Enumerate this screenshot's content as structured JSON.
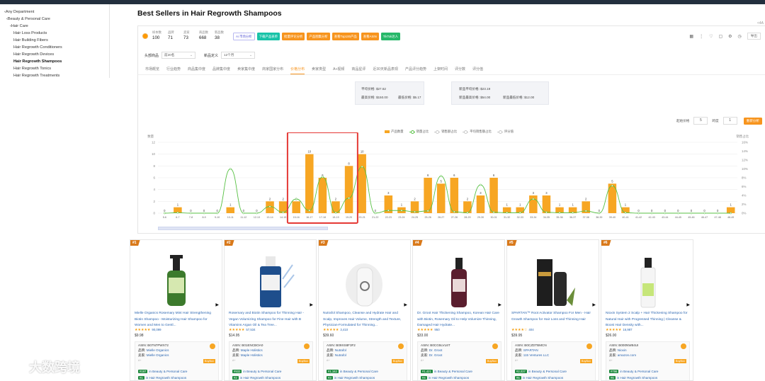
{
  "sidebar": [
    {
      "label": "‹Any Department",
      "level": 0
    },
    {
      "label": "‹Beauty & Personal Care",
      "level": 1
    },
    {
      "label": "‹Hair Care",
      "level": 2
    },
    {
      "label": "Hair Loss Products",
      "level": 3
    },
    {
      "label": "Hair Building Fibers",
      "level": 3
    },
    {
      "label": "Hair Regrowth Conditioners",
      "level": 3
    },
    {
      "label": "Hair Regrowth Devices",
      "level": 3
    },
    {
      "label": "Hair Regrowth Shampoos",
      "level": 3,
      "active": true
    },
    {
      "label": "Hair Regrowth Tonics",
      "level": 3
    },
    {
      "label": "Hair Regrowth Treatments",
      "level": 3
    }
  ],
  "page_title": "Best Sellers in Hair Regrowth Shampoos",
  "corner_label": "<4A",
  "stats": [
    {
      "label": "样本数",
      "value": "100"
    },
    {
      "label": "品牌",
      "value": "71"
    },
    {
      "label": "卖家",
      "value": "73"
    },
    {
      "label": "商品数",
      "value": "668"
    },
    {
      "label": "新品数",
      "value": "38"
    }
  ],
  "action_buttons": [
    {
      "label": "Ai 市场分析",
      "style": "ai"
    },
    {
      "label": "下载产品表单",
      "style": "teal"
    },
    {
      "label": "批量评论分析",
      "style": "orange"
    },
    {
      "label": "产品图集分析",
      "style": "orange"
    },
    {
      "label": "查看Top100产品",
      "style": "orange"
    },
    {
      "label": "查看ASIN",
      "style": "orange"
    },
    {
      "label": "TikTok达人",
      "style": "green"
    }
  ],
  "tool_icons": [
    "grid-icon",
    "more-icon",
    "heart-icon",
    "save-icon",
    "settings-icon",
    "history-icon"
  ],
  "export_label": "导出",
  "filters": {
    "head_label": "头部商品",
    "head_value": "前20名",
    "period_label": "新品定义",
    "period_value": "12个月"
  },
  "tabs": [
    "市场概览",
    "行业趋势",
    "商品集中度",
    "品牌集中度",
    "卖家集中度",
    "商家国家分布",
    "价格分布",
    "卖家类型",
    "A+视频",
    "商品星评",
    "近30天新品表现",
    "产品评分趋势",
    "上架时间",
    "评分数",
    "评分值"
  ],
  "active_tab": "价格分布",
  "price_summary_1": {
    "avg_label": "平均价格:",
    "avg": "$27.62",
    "max_label": "最高价格:",
    "max": "$150.00",
    "min_label": "最低价格:",
    "min": "$5.17"
  },
  "price_summary_2": {
    "avg_label": "新品平均价格:",
    "avg": "$23.19",
    "max_label": "新品最高价格:",
    "max": "$54.00",
    "min_label": "新品最低价格:",
    "min": "$12.00"
  },
  "range_controls": {
    "start_label": "起始价格",
    "start_value": "5",
    "step_label": "跨度",
    "step_value": "1",
    "button_label": "重新分析"
  },
  "legend": [
    {
      "label": "产品数量",
      "kind": "bar",
      "color": "#f7a623"
    },
    {
      "label": "销量占比",
      "kind": "line",
      "color": "#58c144"
    },
    {
      "label": "销售额占比",
      "kind": "line",
      "color": "#c8c8c8"
    },
    {
      "label": "平均销售额占比",
      "kind": "line",
      "color": "#c8c8c8"
    },
    {
      "label": "评分值",
      "kind": "line",
      "color": "#c8c8c8"
    }
  ],
  "chart_data": {
    "type": "bar",
    "ylabel": "数量",
    "y2label": "销售占比",
    "ylim": [
      0,
      12
    ],
    "y_ticks": [
      0,
      2,
      4,
      6,
      8,
      10,
      12
    ],
    "y2_ticks": [
      "0%",
      "2%",
      "4%",
      "6%",
      "8%",
      "10%",
      "12%",
      "14%",
      "16%"
    ],
    "categories": [
      "5-6",
      "6-7",
      "7-8",
      "8-9",
      "9-10",
      "10-11",
      "11-12",
      "12-13",
      "13-14",
      "14-15",
      "15-16",
      "16-17",
      "17-18",
      "18-19",
      "19-20",
      "20-21",
      "21-22",
      "22-23",
      "23-24",
      "24-25",
      "25-26",
      "26-27",
      "27-28",
      "28-29",
      "29-30",
      "30-31",
      "31-32",
      "32-33",
      "33-34",
      "34-35",
      "35-36",
      "36-37",
      "37-38",
      "38-39",
      "39-40",
      "40-41",
      "41-42",
      "42-43",
      "43-44",
      "44-45",
      "45-46",
      "46-47",
      "47-48",
      "48-49"
    ],
    "series": [
      {
        "name": "产品数量",
        "values": [
          0,
          1,
          0,
          0,
          0,
          1,
          0,
          0,
          2,
          2,
          2,
          10,
          6,
          2,
          8,
          10,
          0,
          3,
          1,
          2,
          6,
          5,
          6,
          2,
          3,
          6,
          1,
          1,
          3,
          3,
          1,
          1,
          2,
          0,
          5,
          1,
          0,
          0,
          0,
          0,
          0,
          0,
          0,
          1
        ]
      },
      {
        "name": "销量占比",
        "values": [
          0,
          0.1,
          0,
          0,
          0,
          10,
          0,
          0,
          1.5,
          0.2,
          3.2,
          0.6,
          8.2,
          0.1,
          3.4,
          10.5,
          0,
          0.6,
          0.6,
          0.3,
          0.5,
          8.4,
          0.3,
          0.1,
          6.4,
          0.2,
          0.1,
          0.1,
          3.2,
          0.2,
          0.1,
          0.1,
          0.5,
          0,
          6.2,
          0.1,
          0,
          0,
          0,
          0,
          0,
          0,
          0,
          0
        ]
      }
    ],
    "highlight_range": [
      "15-16",
      "19-20"
    ],
    "annotation": "highlight box around 15-16 to 19-20"
  },
  "products": [
    {
      "rank": "#1",
      "title": "Mielle Organics Rosemary Mint Hair Strengthening Biotin Shampoo - Moisturizing Hair Shampoo for Women and Men to Gentl...",
      "stars": "★★★★★",
      "reviews": "90,099",
      "price": "$9.98",
      "asin": "B07N7PWX72",
      "brand_label": "品牌:",
      "brand": "Mielle Organics",
      "seller_label": "卖家:",
      "seller": "Mielle Organics",
      "bsr1_rank": "#197",
      "bsr1_cat": "in Beauty & Personal Care",
      "bsr2_rank": "#1",
      "bsr2_cat": "in Hair Regrowth Shampoos",
      "image": "green-bottle"
    },
    {
      "rank": "#2",
      "title": "Rosemary and Biotin Shampoo for Thinning Hair - Vegan Volumizing Shampoo for Fine Hair with B Vitamins Argan Oil & Tea Tree...",
      "stars": "★★★★★",
      "reviews": "57,534",
      "price": "$14.95",
      "asin": "B01ENCBOA0",
      "brand_label": "品牌:",
      "brand": "Maple Holistics",
      "seller_label": "卖家:",
      "seller": "Maple Holistics",
      "bsr1_rank": "#932",
      "bsr1_cat": "in Beauty & Personal Care",
      "bsr2_rank": "#2",
      "bsr2_cat": "in Hair Regrowth Shampoos",
      "image": "blue-bottle"
    },
    {
      "rank": "#3",
      "title": "Nutrafol Shampoo, Cleanse and Hydrate Hair and Scalp, Improves Hair Volume, Strength and Texture, Physician-Formulated for Thinning...",
      "stars": "★★★★★",
      "reviews": "3,410",
      "price": "$39.60",
      "asin": "B09XS8F3F2",
      "brand_label": "品牌:",
      "brand": "Nutrafol",
      "seller_label": "卖家:",
      "seller": "Nutrafol",
      "bsr1_rank": "#1,162",
      "bsr1_cat": "in Beauty & Personal Care",
      "bsr2_rank": "#3",
      "bsr2_cat": "in Hair Regrowth Shampoos",
      "image": "white-bottle"
    },
    {
      "rank": "#4",
      "title": "Dr. Groot Hair Thickening Shampoo, Korean Hair Care with Biotin, Rosemary Oil to Help Volumize Thinning, Damaged Hair Hydrate...",
      "stars": "★★★★★",
      "reviews": "950",
      "price": "$33.00",
      "asin": "B0CG5LVL6T",
      "brand_label": "品牌:",
      "brand": "Dr. Groot",
      "seller_label": "卖家:",
      "seller": "Dr. Groot",
      "bsr1_rank": "#1,421",
      "bsr1_cat": "in Beauty & Personal Care",
      "bsr2_rank": "#4",
      "bsr2_cat": "in Hair Regrowth Shampoos",
      "image": "red-bottle"
    },
    {
      "rank": "#5",
      "title": "SPARTAN™ Root Activator Shampoo For Men - Hair Growth Shampoo for Hair Loss and Thinning Hair",
      "stars": "★★★★☆",
      "reviews": "404",
      "price": "$39.95",
      "asin": "B0CZDTBMCN",
      "brand_label": "品牌:",
      "brand": "SPARTAN",
      "seller_label": "卖家:",
      "seller": "115 Ventures LLC",
      "bsr1_rank": "#2,037",
      "bsr1_cat": "in Beauty & Personal Care",
      "bsr2_rank": "#5",
      "bsr2_cat": "in Hair Regrowth Shampoos",
      "image": "black-bottle"
    },
    {
      "rank": "#6",
      "title": "Nioxin System 2 Scalp + Hair Thickening Shampoo for Natural Hair with Progressed Thinning | Cleanse & Boost Hair Density with...",
      "stars": "★★★★★",
      "reviews": "16,987",
      "price": "$26.00",
      "asin": "B000NW84UI",
      "brand_label": "品牌:",
      "brand": "Nioxin",
      "seller_label": "卖家:",
      "seller": "amazon.com",
      "bsr1_rank": "#796",
      "bsr1_cat": "in Beauty & Personal Care",
      "bsr2_rank": "#6",
      "bsr2_cat": "in Hair Regrowth Shampoos",
      "image": "white-green-bottle"
    }
  ],
  "asin_label": "ASIN:",
  "tag_label": "BuyBox",
  "small_label": "A+",
  "watermark": "大数跨境",
  "colors": {
    "accent": "#f7941d",
    "bar": "#f7a623",
    "line": "#58c144",
    "highlight": "#e53935",
    "link": "#2a65b0"
  }
}
